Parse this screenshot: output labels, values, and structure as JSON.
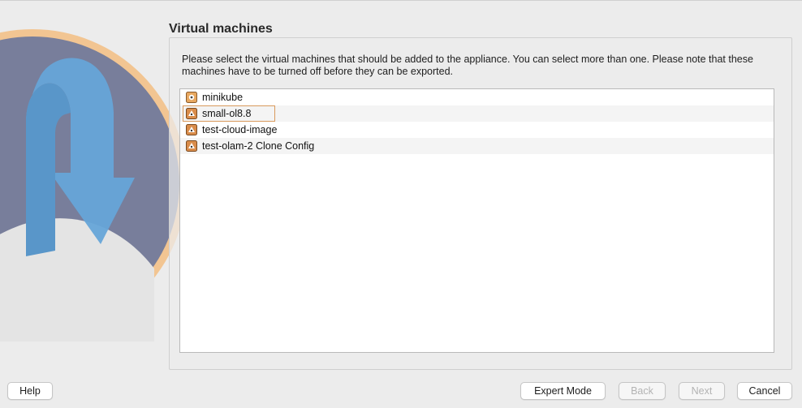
{
  "page": {
    "title": "Virtual machines",
    "description": "Please select the virtual machines that should be added to the appliance. You can select more than one. Please note that these machines have to be turned off before they can be exported."
  },
  "vm_list": {
    "items": [
      {
        "label": "minikube",
        "icon": "vm-os-icon"
      },
      {
        "label": "small-ol8.8",
        "icon": "vm-os-icon"
      },
      {
        "label": "test-cloud-image",
        "icon": "vm-os-icon"
      },
      {
        "label": "test-olam-2 Clone Config",
        "icon": "vm-os-icon"
      }
    ]
  },
  "buttons": {
    "help": "Help",
    "expert_mode": "Expert Mode",
    "back": "Back",
    "next": "Next",
    "cancel": "Cancel"
  },
  "colors": {
    "hero_ring": "#f2c28a",
    "hero_disc": "#6e7594",
    "hero_arrow": "#5b9fd6",
    "focus_ring": "#d99a5c"
  }
}
